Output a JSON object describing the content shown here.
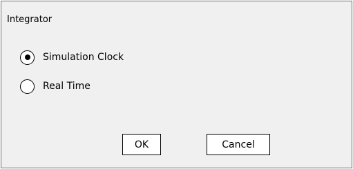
{
  "dialog": {
    "title": "Integrator",
    "options": [
      {
        "label": "Simulation Clock",
        "selected": true
      },
      {
        "label": "Real Time",
        "selected": false
      }
    ],
    "ok_label": "OK",
    "cancel_label": "Cancel"
  }
}
